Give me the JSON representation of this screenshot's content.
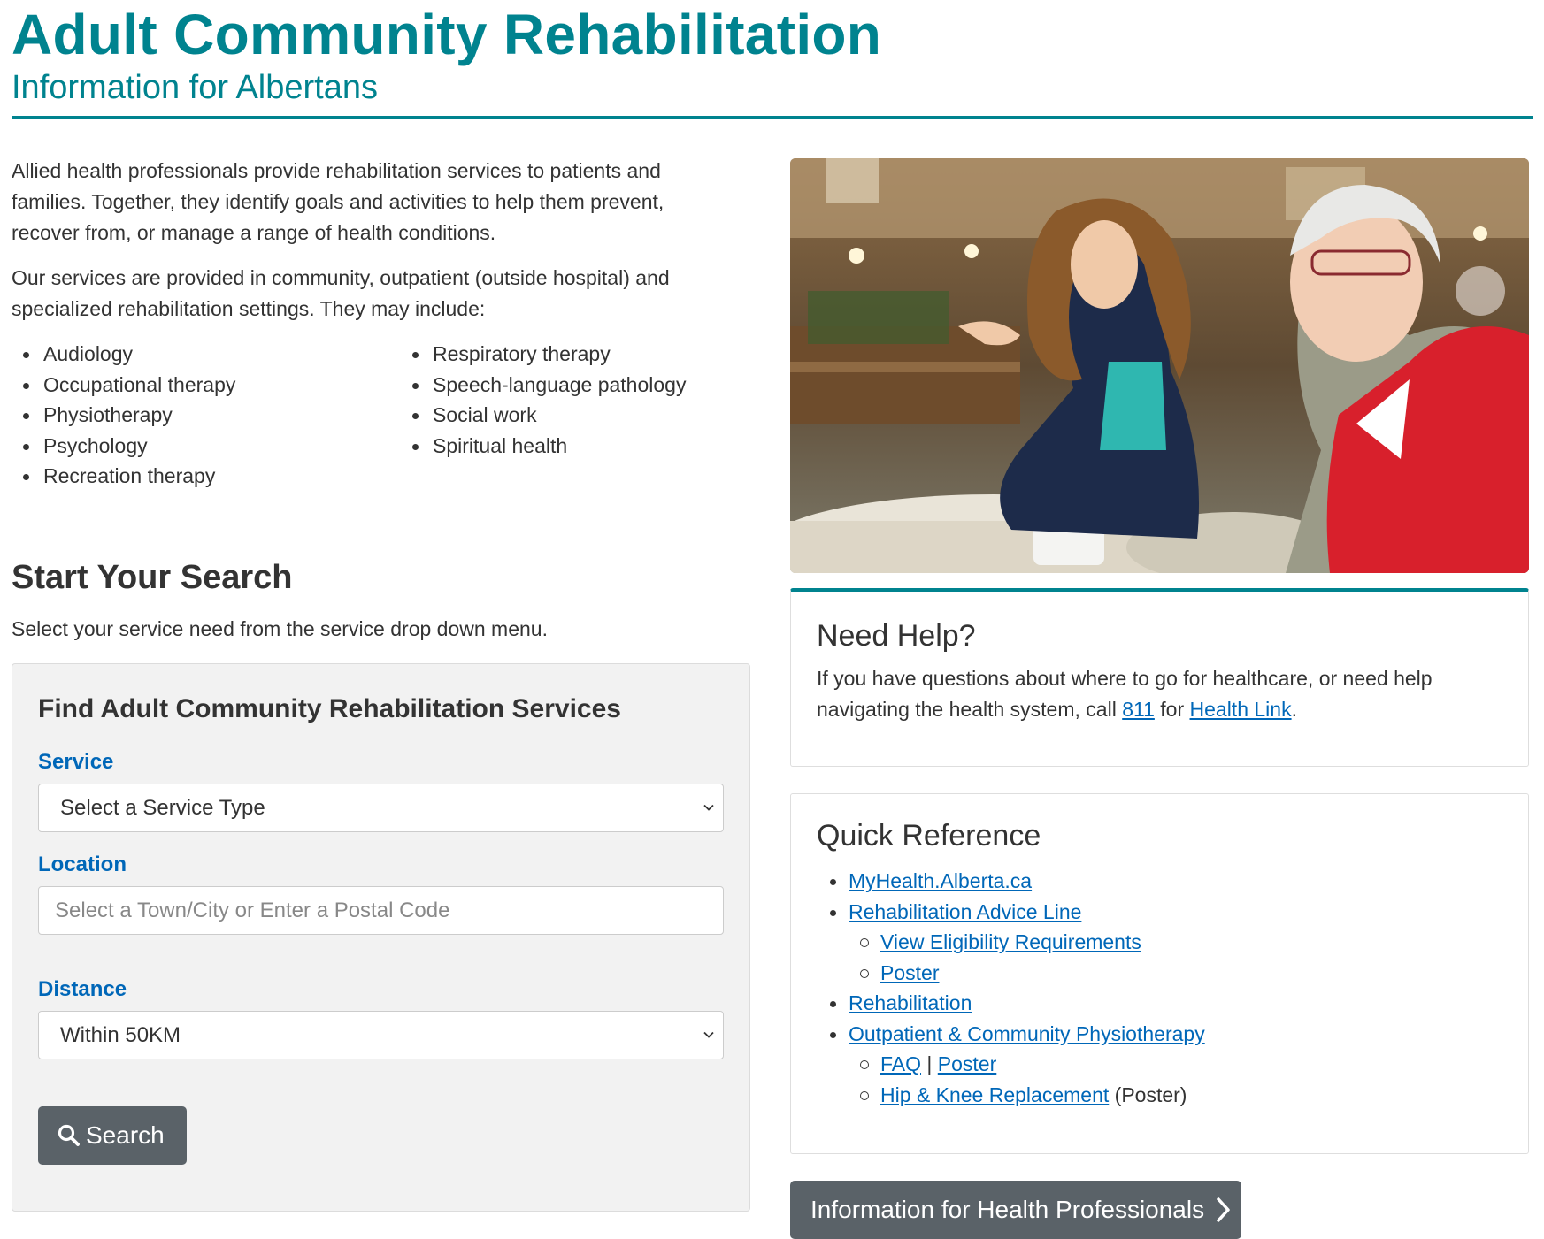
{
  "header": {
    "title": "Adult Community Rehabilitation",
    "subtitle": "Information for Albertans"
  },
  "intro": {
    "paragraph1": "Allied health professionals provide rehabilitation services to patients and families. Together, they identify goals and activities to help them prevent, recover from, or manage a range of health conditions.",
    "paragraph2": "Our services are provided in community, outpatient (outside hospital) and specialized rehabilitation settings. They may include:",
    "services_col1": [
      "Audiology",
      "Occupational therapy",
      "Physiotherapy",
      "Psychology",
      "Recreation therapy"
    ],
    "services_col2": [
      "Respiratory therapy",
      "Speech-language pathology",
      "Social work",
      "Spiritual health"
    ]
  },
  "search": {
    "heading": "Start Your Search",
    "description": "Select your service need from the service drop down menu.",
    "form_title": "Find Adult Community Rehabilitation Services",
    "service_label": "Service",
    "service_value": "Select a Service Type",
    "location_label": "Location",
    "location_placeholder": "Select a Town/City or Enter a Postal Code",
    "distance_label": "Distance",
    "distance_value": "Within 50KM",
    "button_label": "Search"
  },
  "need_help": {
    "title": "Need Help?",
    "text_before": "If you have questions about where to go for healthcare, or need help navigating the health system, call ",
    "phone_link": "811",
    "text_middle": " for ",
    "healthlink_link": "Health Link",
    "text_after": "."
  },
  "quick_reference": {
    "title": "Quick Reference",
    "myhealth": "MyHealth.Alberta.ca",
    "advice_line": "Rehabilitation Advice Line",
    "eligibility": "View Eligibility Requirements",
    "advice_poster": "Poster",
    "rehabilitation": "Rehabilitation",
    "physio": "Outpatient & Community Physiotherapy",
    "faq": "FAQ",
    "separator": " | ",
    "physio_poster": "Poster",
    "hip_knee": "Hip & Knee Replacement",
    "hip_knee_suffix": " (Poster)"
  },
  "professionals_button": "Information for Health Professionals",
  "colors": {
    "brand_teal": "#00838f",
    "link_blue": "#0067b8",
    "button_gray": "#5a6268"
  }
}
